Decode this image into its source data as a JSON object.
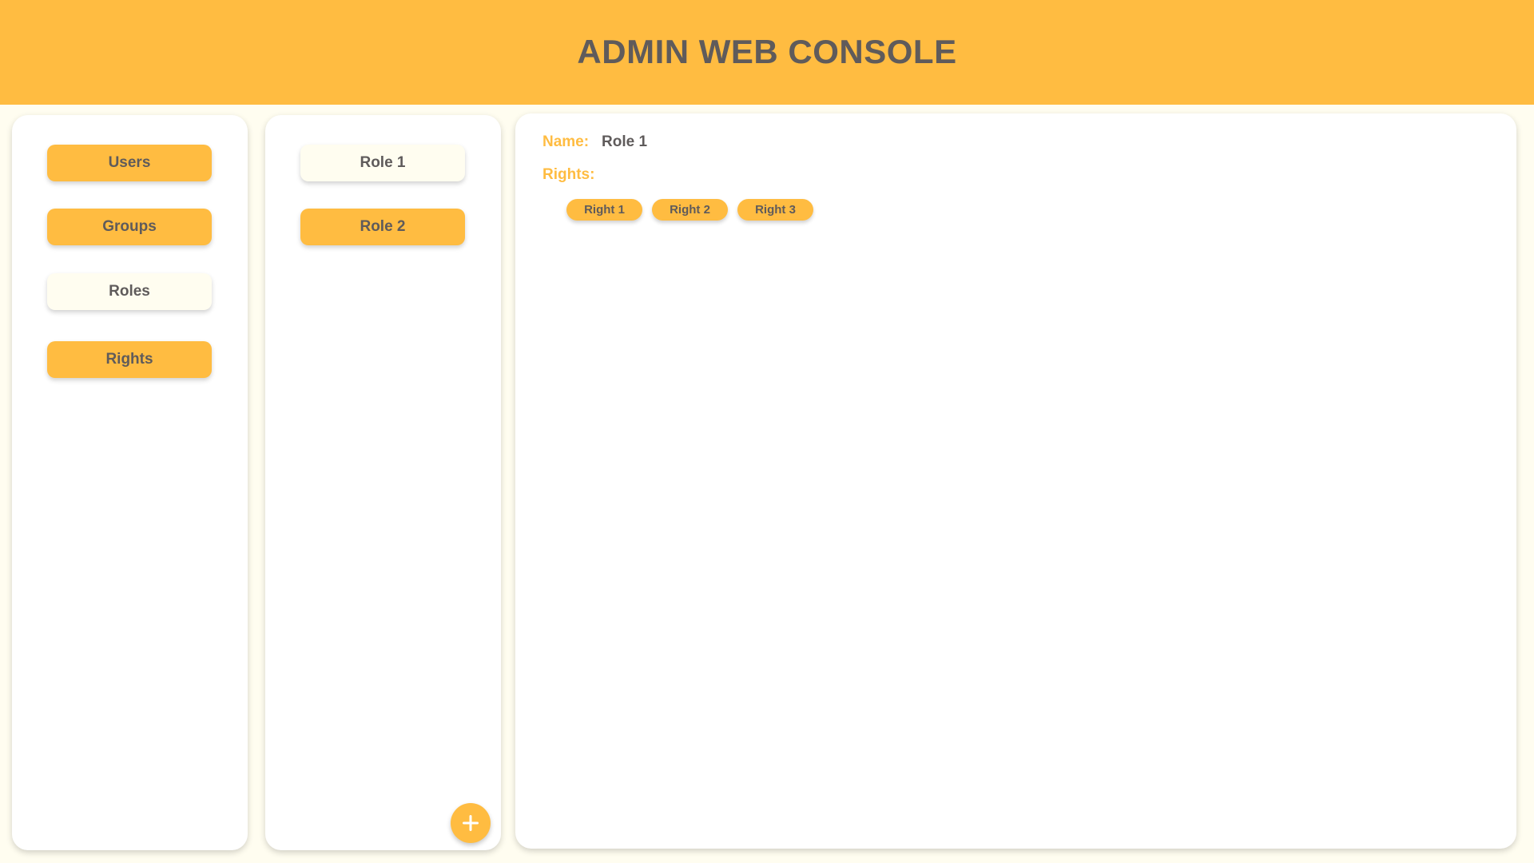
{
  "header": {
    "title": "ADMIN WEB CONSOLE"
  },
  "nav": {
    "items": [
      {
        "label": "Users",
        "active": false
      },
      {
        "label": "Groups",
        "active": false
      },
      {
        "label": "Roles",
        "active": true
      },
      {
        "label": "Rights",
        "active": false
      }
    ]
  },
  "roles": {
    "items": [
      {
        "label": "Role 1",
        "active": true
      },
      {
        "label": "Role 2",
        "active": false
      }
    ],
    "add_icon": "plus-icon"
  },
  "detail": {
    "name_label": "Name:",
    "name_value": "Role 1",
    "rights_label": "Rights:",
    "rights": [
      "Right 1",
      "Right 2",
      "Right 3"
    ]
  },
  "colors": {
    "accent": "#ffbc41",
    "background": "#fffdf0",
    "panel": "#ffffff",
    "text": "#5f5b5b"
  }
}
